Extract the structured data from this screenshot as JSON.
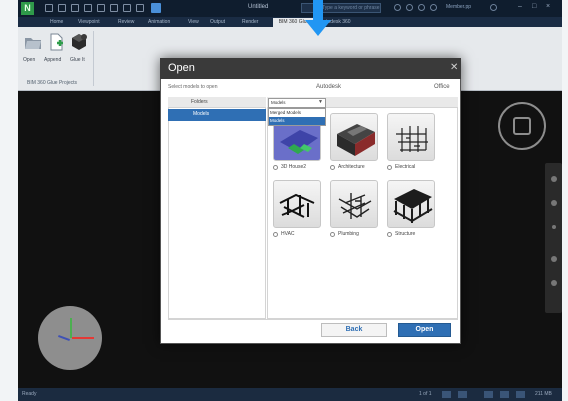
{
  "window": {
    "title": "Untitled",
    "search_placeholder": "Type a keyword or phrase",
    "user": "Member.pp"
  },
  "tabs": [
    "Home",
    "Viewpoint",
    "Review",
    "Animation",
    "View",
    "Output",
    "Render",
    "BIM 360 Glue",
    "Autodesk 360"
  ],
  "ribbon": {
    "buttons": [
      "Open",
      "Append",
      "Glue It"
    ],
    "group_label": "BIM 360 Glue Projects"
  },
  "dialog": {
    "title": "Open",
    "subtitle": "Select models to open",
    "sources": [
      "Autodesk",
      "Office"
    ],
    "folders_header": "Folders",
    "folders": [
      "Models"
    ],
    "dropdown": {
      "selected": "Models",
      "options": [
        "Merged Models",
        "Models"
      ]
    },
    "models": [
      "3D House2",
      "Architecture",
      "Electrical",
      "HVAC",
      "Plumbing",
      "Structure"
    ],
    "back_label": "Back",
    "open_label": "Open"
  },
  "status": {
    "text": "Ready",
    "page": "1 of 1",
    "zoom": "211 MB"
  },
  "colors": {
    "accent": "#2f6fb4",
    "arrow": "#2196f3",
    "titlebar": "#0f1d2e"
  }
}
